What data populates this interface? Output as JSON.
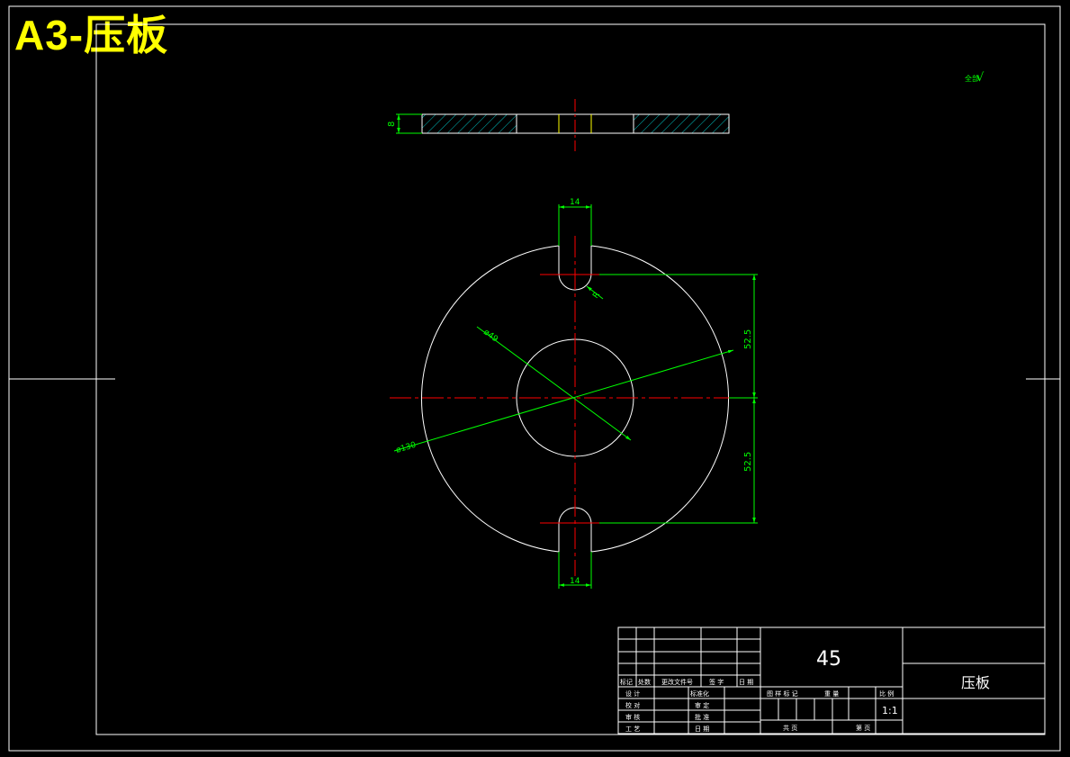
{
  "banner": {
    "title": "A3-压板"
  },
  "roughness": {
    "symbol": "√",
    "note": "全部"
  },
  "dimensions": {
    "thickness": "8",
    "slot_width_top": "14",
    "slot_width_bottom": "14",
    "radius": "R",
    "upper_offset": "52.5",
    "lower_offset": "52.5",
    "inner_diameter": "ø49",
    "outer_diameter": "ø130"
  },
  "title_block": {
    "material": "45",
    "part_name": "压板",
    "scale": "1:1",
    "rev_headers": [
      "标记",
      "处数",
      "更改文件号",
      "签 字",
      "日 期"
    ],
    "row_labels": [
      "设 计",
      "校 对",
      "审 核",
      "工 艺"
    ],
    "mid_labels": [
      "标准化",
      "审 定",
      "批 准",
      "日 期"
    ],
    "right_headers": [
      "图 样 标 记",
      "重 量",
      "比 例"
    ],
    "sheet_total": "共 页",
    "sheet_no": "第 页"
  },
  "colors": {
    "outline": "#ffffff",
    "dimension": "#00ff00",
    "centerline": "#ff0000",
    "banner": "#ffff00",
    "hatch": "#00c0c0"
  }
}
